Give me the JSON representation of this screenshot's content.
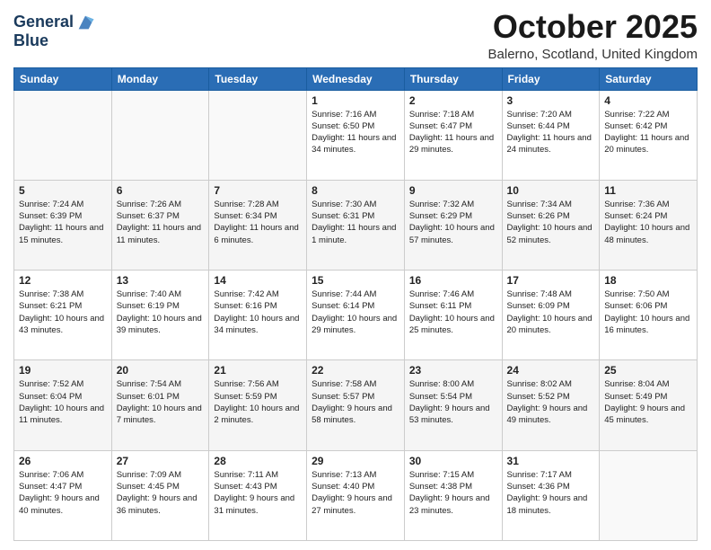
{
  "logo": {
    "line1": "General",
    "line2": "Blue"
  },
  "title": "October 2025",
  "location": "Balerno, Scotland, United Kingdom",
  "days_of_week": [
    "Sunday",
    "Monday",
    "Tuesday",
    "Wednesday",
    "Thursday",
    "Friday",
    "Saturday"
  ],
  "weeks": [
    [
      {
        "day": "",
        "sunrise": "",
        "sunset": "",
        "daylight": ""
      },
      {
        "day": "",
        "sunrise": "",
        "sunset": "",
        "daylight": ""
      },
      {
        "day": "",
        "sunrise": "",
        "sunset": "",
        "daylight": ""
      },
      {
        "day": "1",
        "sunrise": "Sunrise: 7:16 AM",
        "sunset": "Sunset: 6:50 PM",
        "daylight": "Daylight: 11 hours and 34 minutes."
      },
      {
        "day": "2",
        "sunrise": "Sunrise: 7:18 AM",
        "sunset": "Sunset: 6:47 PM",
        "daylight": "Daylight: 11 hours and 29 minutes."
      },
      {
        "day": "3",
        "sunrise": "Sunrise: 7:20 AM",
        "sunset": "Sunset: 6:44 PM",
        "daylight": "Daylight: 11 hours and 24 minutes."
      },
      {
        "day": "4",
        "sunrise": "Sunrise: 7:22 AM",
        "sunset": "Sunset: 6:42 PM",
        "daylight": "Daylight: 11 hours and 20 minutes."
      }
    ],
    [
      {
        "day": "5",
        "sunrise": "Sunrise: 7:24 AM",
        "sunset": "Sunset: 6:39 PM",
        "daylight": "Daylight: 11 hours and 15 minutes."
      },
      {
        "day": "6",
        "sunrise": "Sunrise: 7:26 AM",
        "sunset": "Sunset: 6:37 PM",
        "daylight": "Daylight: 11 hours and 11 minutes."
      },
      {
        "day": "7",
        "sunrise": "Sunrise: 7:28 AM",
        "sunset": "Sunset: 6:34 PM",
        "daylight": "Daylight: 11 hours and 6 minutes."
      },
      {
        "day": "8",
        "sunrise": "Sunrise: 7:30 AM",
        "sunset": "Sunset: 6:31 PM",
        "daylight": "Daylight: 11 hours and 1 minute."
      },
      {
        "day": "9",
        "sunrise": "Sunrise: 7:32 AM",
        "sunset": "Sunset: 6:29 PM",
        "daylight": "Daylight: 10 hours and 57 minutes."
      },
      {
        "day": "10",
        "sunrise": "Sunrise: 7:34 AM",
        "sunset": "Sunset: 6:26 PM",
        "daylight": "Daylight: 10 hours and 52 minutes."
      },
      {
        "day": "11",
        "sunrise": "Sunrise: 7:36 AM",
        "sunset": "Sunset: 6:24 PM",
        "daylight": "Daylight: 10 hours and 48 minutes."
      }
    ],
    [
      {
        "day": "12",
        "sunrise": "Sunrise: 7:38 AM",
        "sunset": "Sunset: 6:21 PM",
        "daylight": "Daylight: 10 hours and 43 minutes."
      },
      {
        "day": "13",
        "sunrise": "Sunrise: 7:40 AM",
        "sunset": "Sunset: 6:19 PM",
        "daylight": "Daylight: 10 hours and 39 minutes."
      },
      {
        "day": "14",
        "sunrise": "Sunrise: 7:42 AM",
        "sunset": "Sunset: 6:16 PM",
        "daylight": "Daylight: 10 hours and 34 minutes."
      },
      {
        "day": "15",
        "sunrise": "Sunrise: 7:44 AM",
        "sunset": "Sunset: 6:14 PM",
        "daylight": "Daylight: 10 hours and 29 minutes."
      },
      {
        "day": "16",
        "sunrise": "Sunrise: 7:46 AM",
        "sunset": "Sunset: 6:11 PM",
        "daylight": "Daylight: 10 hours and 25 minutes."
      },
      {
        "day": "17",
        "sunrise": "Sunrise: 7:48 AM",
        "sunset": "Sunset: 6:09 PM",
        "daylight": "Daylight: 10 hours and 20 minutes."
      },
      {
        "day": "18",
        "sunrise": "Sunrise: 7:50 AM",
        "sunset": "Sunset: 6:06 PM",
        "daylight": "Daylight: 10 hours and 16 minutes."
      }
    ],
    [
      {
        "day": "19",
        "sunrise": "Sunrise: 7:52 AM",
        "sunset": "Sunset: 6:04 PM",
        "daylight": "Daylight: 10 hours and 11 minutes."
      },
      {
        "day": "20",
        "sunrise": "Sunrise: 7:54 AM",
        "sunset": "Sunset: 6:01 PM",
        "daylight": "Daylight: 10 hours and 7 minutes."
      },
      {
        "day": "21",
        "sunrise": "Sunrise: 7:56 AM",
        "sunset": "Sunset: 5:59 PM",
        "daylight": "Daylight: 10 hours and 2 minutes."
      },
      {
        "day": "22",
        "sunrise": "Sunrise: 7:58 AM",
        "sunset": "Sunset: 5:57 PM",
        "daylight": "Daylight: 9 hours and 58 minutes."
      },
      {
        "day": "23",
        "sunrise": "Sunrise: 8:00 AM",
        "sunset": "Sunset: 5:54 PM",
        "daylight": "Daylight: 9 hours and 53 minutes."
      },
      {
        "day": "24",
        "sunrise": "Sunrise: 8:02 AM",
        "sunset": "Sunset: 5:52 PM",
        "daylight": "Daylight: 9 hours and 49 minutes."
      },
      {
        "day": "25",
        "sunrise": "Sunrise: 8:04 AM",
        "sunset": "Sunset: 5:49 PM",
        "daylight": "Daylight: 9 hours and 45 minutes."
      }
    ],
    [
      {
        "day": "26",
        "sunrise": "Sunrise: 7:06 AM",
        "sunset": "Sunset: 4:47 PM",
        "daylight": "Daylight: 9 hours and 40 minutes."
      },
      {
        "day": "27",
        "sunrise": "Sunrise: 7:09 AM",
        "sunset": "Sunset: 4:45 PM",
        "daylight": "Daylight: 9 hours and 36 minutes."
      },
      {
        "day": "28",
        "sunrise": "Sunrise: 7:11 AM",
        "sunset": "Sunset: 4:43 PM",
        "daylight": "Daylight: 9 hours and 31 minutes."
      },
      {
        "day": "29",
        "sunrise": "Sunrise: 7:13 AM",
        "sunset": "Sunset: 4:40 PM",
        "daylight": "Daylight: 9 hours and 27 minutes."
      },
      {
        "day": "30",
        "sunrise": "Sunrise: 7:15 AM",
        "sunset": "Sunset: 4:38 PM",
        "daylight": "Daylight: 9 hours and 23 minutes."
      },
      {
        "day": "31",
        "sunrise": "Sunrise: 7:17 AM",
        "sunset": "Sunset: 4:36 PM",
        "daylight": "Daylight: 9 hours and 18 minutes."
      },
      {
        "day": "",
        "sunrise": "",
        "sunset": "",
        "daylight": ""
      }
    ]
  ]
}
